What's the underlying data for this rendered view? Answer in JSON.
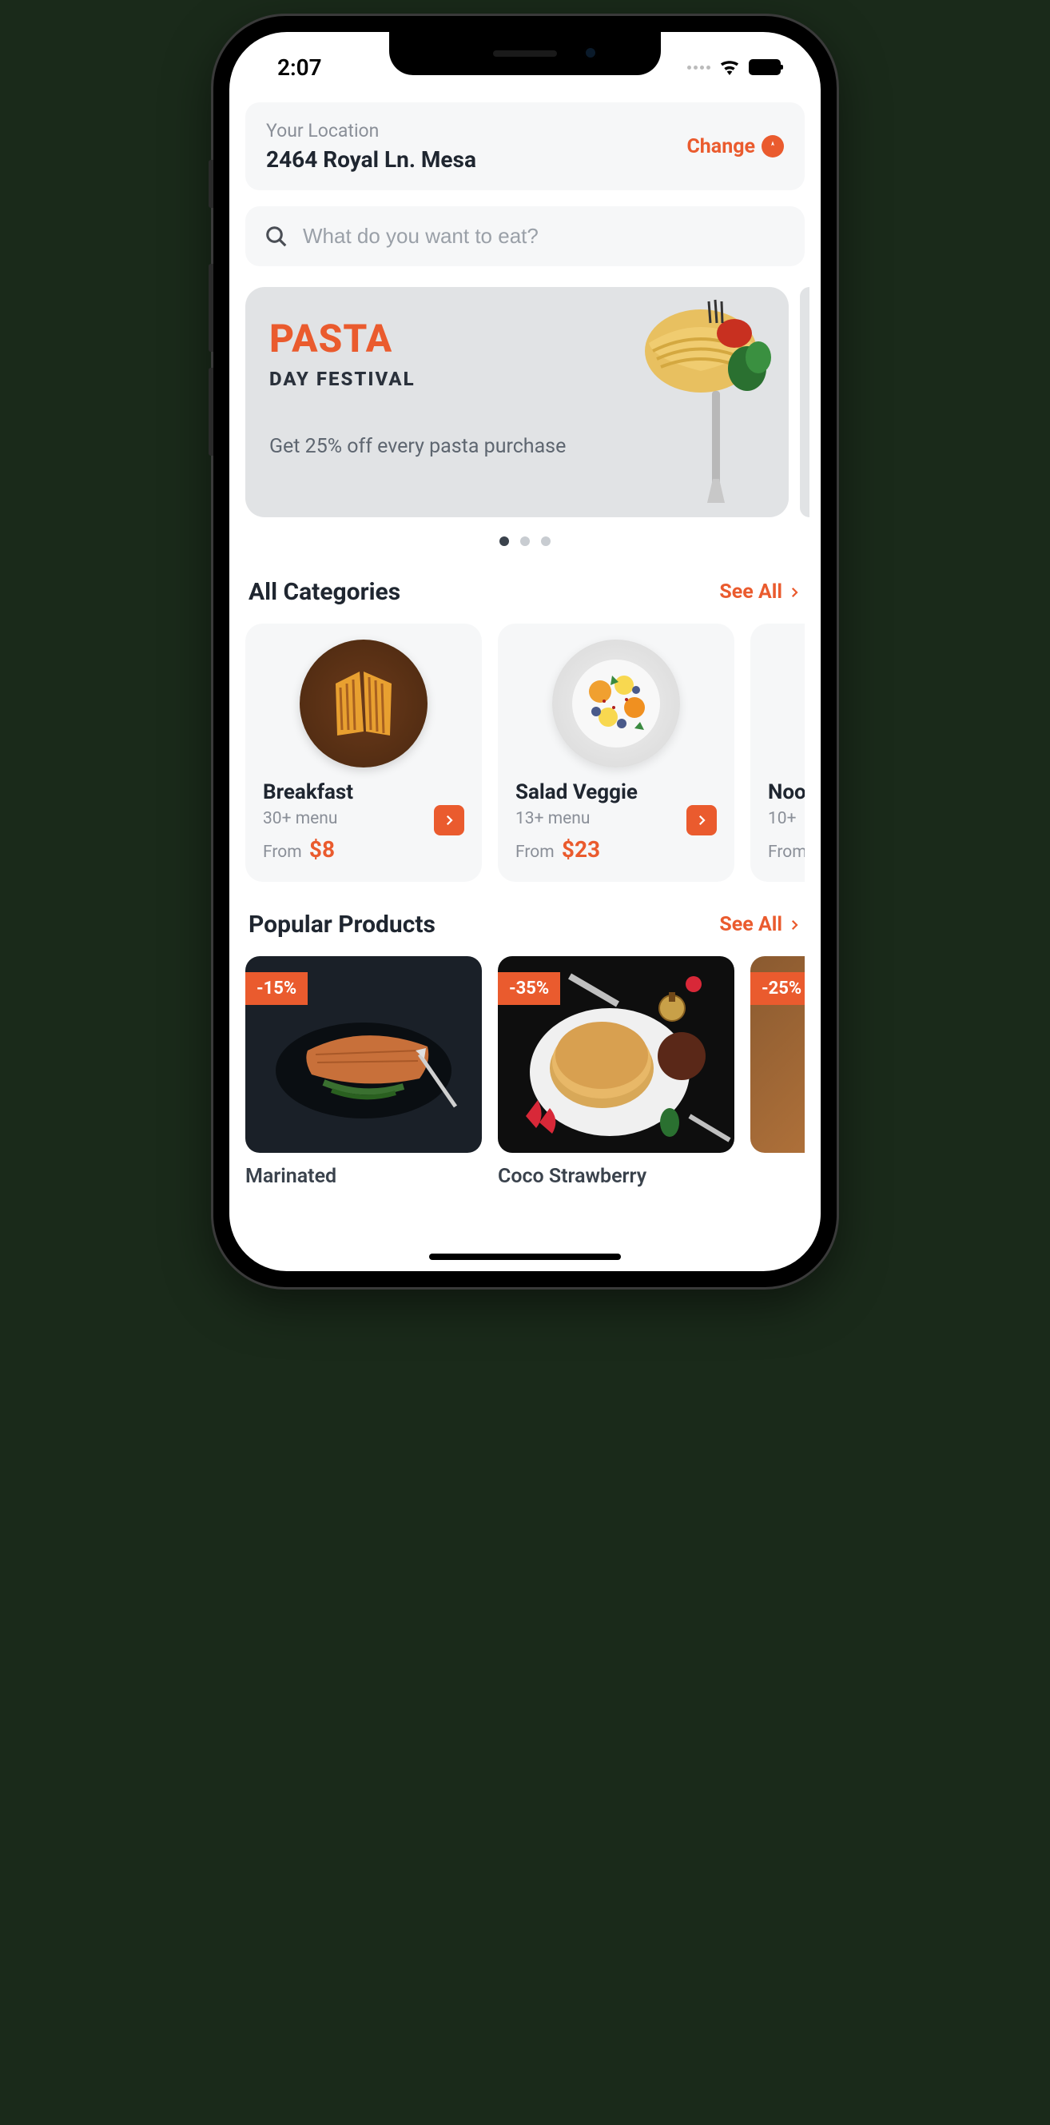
{
  "status": {
    "time": "2:07"
  },
  "accent_color": "#EA5B2E",
  "location": {
    "label": "Your Location",
    "address": "2464 Royal Ln. Mesa",
    "change_label": "Change"
  },
  "search": {
    "placeholder": "What do you want to eat?"
  },
  "banner": {
    "title": "PASTA",
    "subtitle": "DAY FESTIVAL",
    "offer": "Get 25% off every pasta purchase",
    "active_index": 0,
    "count": 3
  },
  "sections": {
    "categories_title": "All Categories",
    "popular_title": "Popular Products",
    "see_all_label": "See All"
  },
  "categories": [
    {
      "name": "Breakfast",
      "menu": "30+ menu",
      "from_label": "From",
      "price": "$8"
    },
    {
      "name": "Salad Veggie",
      "menu": "13+ menu",
      "from_label": "From",
      "price": "$23"
    },
    {
      "name": "Noodles",
      "menu": "10+",
      "from_label": "From",
      "price": ""
    }
  ],
  "products": [
    {
      "name": "Marinated",
      "discount": "-15%"
    },
    {
      "name": "Coco Strawberry",
      "discount": "-35%"
    },
    {
      "name": "",
      "discount": "-25%"
    }
  ]
}
